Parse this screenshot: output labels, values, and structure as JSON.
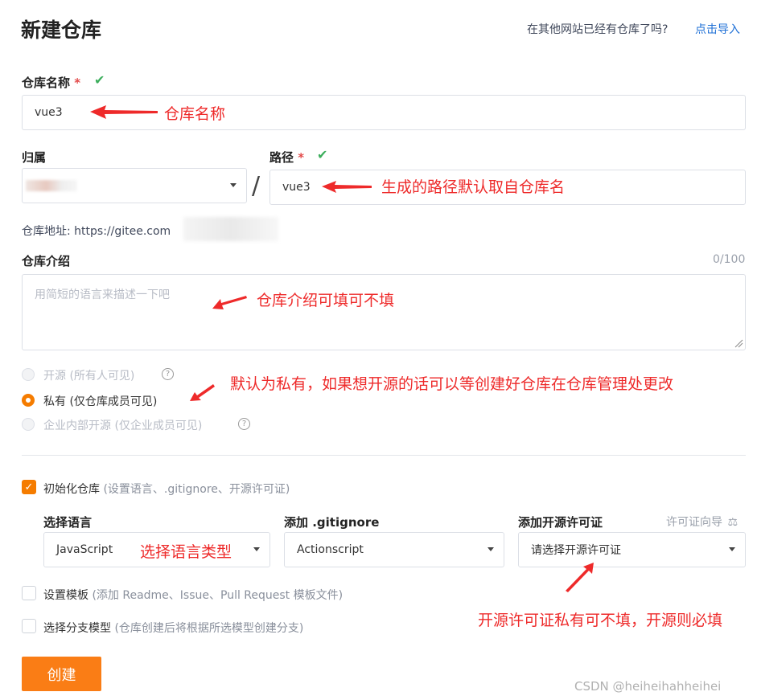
{
  "page": {
    "title": "新建仓库"
  },
  "import": {
    "question": "在其他网站已经有仓库了吗?",
    "link": "点击导入"
  },
  "repo_name": {
    "label": "仓库名称",
    "required": "*",
    "check": "✔",
    "value": "vue3"
  },
  "owner": {
    "label": "归属"
  },
  "path": {
    "label": "路径",
    "required": "*",
    "check": "✔",
    "value": "vue3"
  },
  "slash": "/",
  "address": {
    "prefix": "仓库地址: https://gitee.com"
  },
  "desc": {
    "label": "仓库介绍",
    "counter": "0/100",
    "placeholder": "用简短的语言来描述一下吧"
  },
  "visibility": {
    "open": "开源 (所有人可见)",
    "private": "私有 (仅仓库成员可见)",
    "enterprise": "企业内部开源 (仅企业成员可见)"
  },
  "init": {
    "label": "初始化仓库",
    "hint": "(设置语言、.gitignore、开源许可证)"
  },
  "language": {
    "label": "选择语言",
    "value": "JavaScript"
  },
  "gitignore": {
    "label": "添加 .gitignore",
    "value": "Actionscript"
  },
  "license": {
    "label": "添加开源许可证",
    "guide": "许可证向导",
    "placeholder": "请选择开源许可证"
  },
  "template": {
    "label": "设置模板",
    "hint": "(添加 Readme、Issue、Pull Request 模板文件)"
  },
  "branch": {
    "label": "选择分支模型",
    "hint": "(仓库创建后将根据所选模型创建分支)"
  },
  "create_button": "创建",
  "annotations": {
    "name": "仓库名称",
    "path": "生成的路径默认取自仓库名",
    "desc": "仓库介绍可填可不填",
    "private": "默认为私有，如果想开源的话可以等创建好仓库在仓库管理处更改",
    "language": "选择语言类型",
    "license": "开源许可证私有可不填，开源则必填"
  },
  "watermark": "CSDN @heiheihahheihei",
  "colors": {
    "accent": "#fa7d15",
    "link": "#1d6fd6",
    "annotation": "#ee2a2a",
    "check": "#3cae5c"
  }
}
